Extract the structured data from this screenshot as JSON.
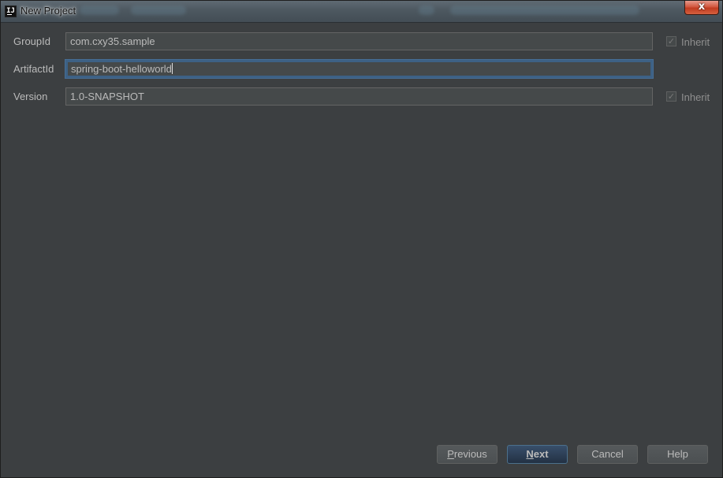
{
  "window": {
    "title": "New Project",
    "app_icon": "IJ",
    "close_glyph": "x"
  },
  "form": {
    "group_id": {
      "label": "GroupId",
      "value": "com.cxy35.sample",
      "inherit_label": "Inherit",
      "inherit_checked": true
    },
    "artifact_id": {
      "label": "ArtifactId",
      "value": "spring-boot-helloworld"
    },
    "version": {
      "label": "Version",
      "value": "1.0-SNAPSHOT",
      "inherit_label": "Inherit",
      "inherit_checked": true
    }
  },
  "buttons": {
    "previous_mnemonic": "P",
    "previous_rest": "revious",
    "next_mnemonic": "N",
    "next_rest": "ext",
    "cancel": "Cancel",
    "help": "Help"
  },
  "check_glyph": "✓",
  "colors": {
    "background": "#3c3f41",
    "field_bg": "#45494a",
    "focus_border": "#3d6185",
    "primary_button": "#233143"
  }
}
